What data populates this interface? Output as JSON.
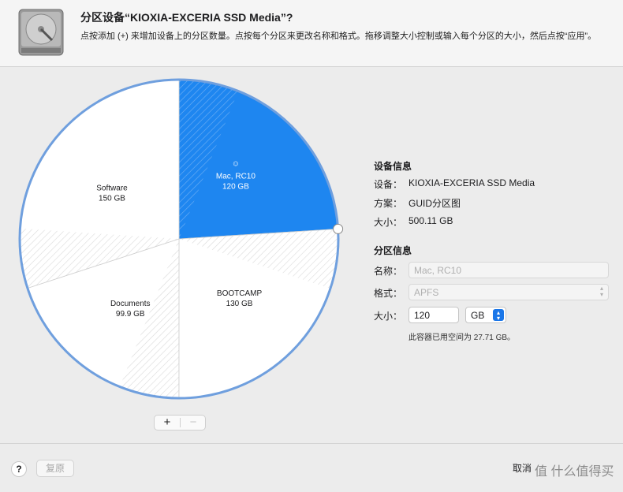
{
  "header": {
    "title": "分区设备“KIOXIA-EXCERIA SSD Media”?",
    "subtitle": "点按添加 (+) 来增加设备上的分区数量。点按每个分区来更改名称和格式。拖移调整大小控制或输入每个分区的大小，然后点按“应用”。"
  },
  "partitions": [
    {
      "name": "Mac, RC10",
      "size": "120 GB",
      "gb": 120,
      "selected": true
    },
    {
      "name": "BOOTCAMP",
      "size": "130 GB",
      "gb": 130,
      "selected": false
    },
    {
      "name": "Documents",
      "size": "99.9 GB",
      "gb": 99.9,
      "selected": false
    },
    {
      "name": "Software",
      "size": "150 GB",
      "gb": 150,
      "selected": false
    }
  ],
  "colors": {
    "selected": "#1e86f0",
    "ring": "#6f9fde",
    "unselected": "#ffffff"
  },
  "device_info": {
    "heading": "设备信息",
    "device_key": "设备：",
    "device_val": "KIOXIA-EXCERIA SSD Media",
    "scheme_key": "方案：",
    "scheme_val": "GUID分区图",
    "size_key": "大小：",
    "size_val": "500.11 GB"
  },
  "partition_info": {
    "heading": "分区信息",
    "name_key": "名称：",
    "name_placeholder": "Mac, RC10",
    "format_key": "格式：",
    "format_val": "APFS",
    "size_key": "大小：",
    "size_val": "120",
    "unit_val": "GB",
    "used_hint": "此容器已用空间为 27.71 GB。"
  },
  "controls": {
    "add_label": "+",
    "remove_label": "−"
  },
  "footer": {
    "help_label": "?",
    "revert_label": "复原",
    "cancel_label": "取消"
  },
  "watermark": "值  什么值得买"
}
